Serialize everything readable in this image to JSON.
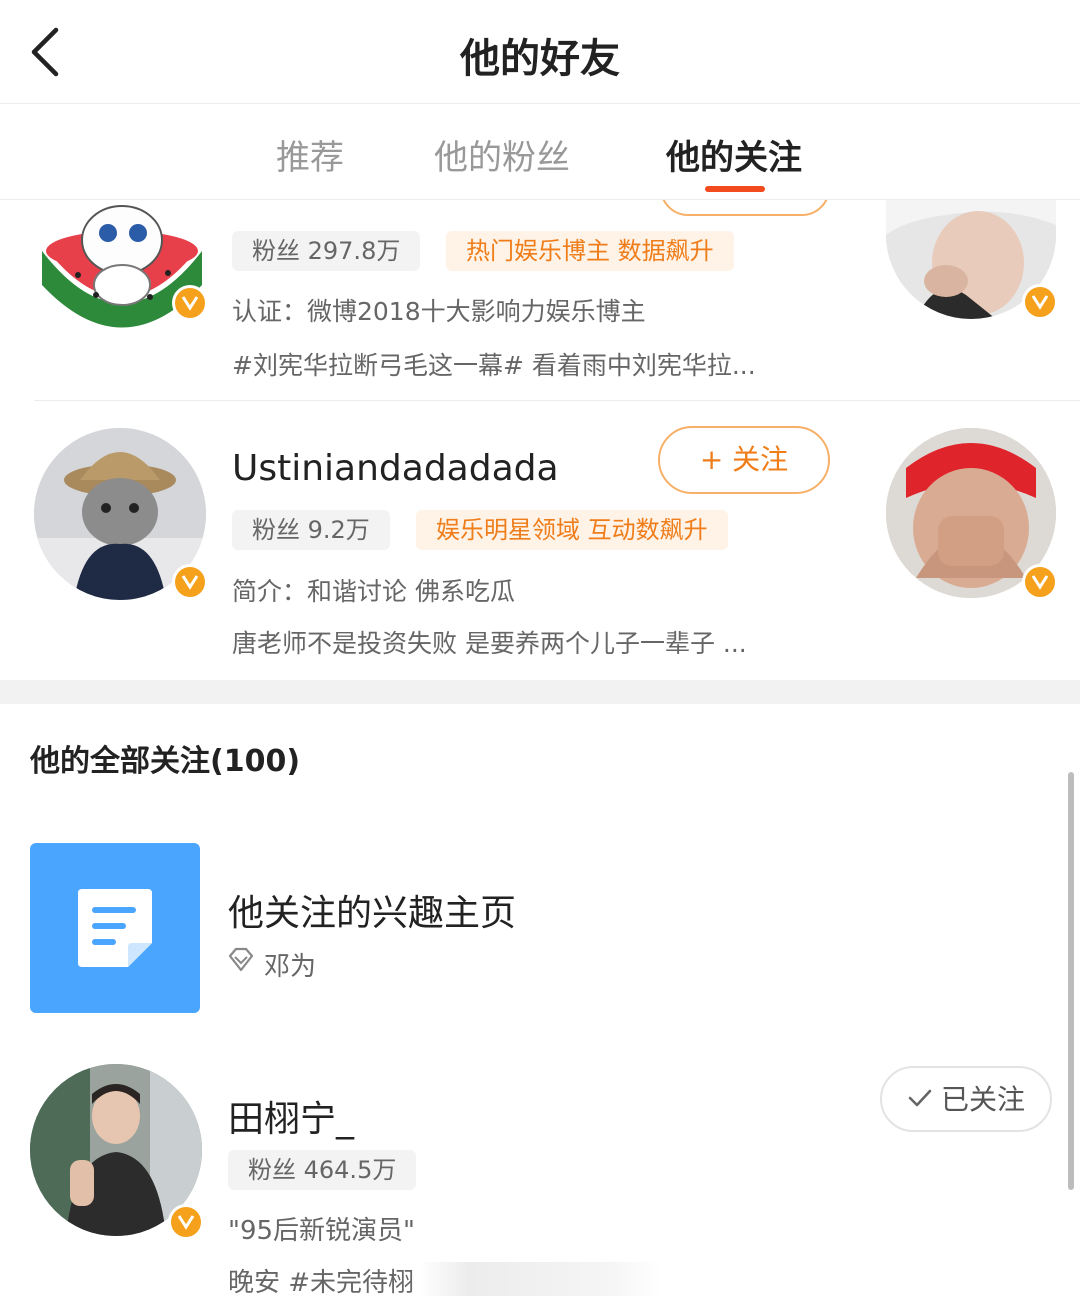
{
  "header": {
    "title": "他的好友",
    "back_icon": "chevron-left-icon"
  },
  "tabs": [
    {
      "label": "推荐",
      "active": false
    },
    {
      "label": "他的粉丝",
      "active": false
    },
    {
      "label": "他的关注",
      "active": true
    }
  ],
  "colors": {
    "accent": "#f24c1e",
    "orange_text": "#ef7d1a",
    "badge": "#f5a11c",
    "interest_blue": "#4aa5ff"
  },
  "recommend_cards": [
    {
      "name": "",
      "fans_chip": "粉丝 297.8万",
      "tag_chip": "热门娱乐博主 数据飙升",
      "line1": "认证：微博2018十大影响力娱乐博主",
      "line2": "#刘宪华拉断弓毛这一幕# 看着雨中刘宪华拉..."
    },
    {
      "name": "Ustiniandadadada",
      "follow_label": "+ 关注",
      "fans_chip": "粉丝 9.2万",
      "tag_chip": "娱乐明星领域 互动数飙升",
      "line1": "简介：和谐讨论 佛系吃瓜",
      "line2": "唐老师不是投资失败 是要养两个儿子一辈子 ..."
    }
  ],
  "all_follows": {
    "title": "他的全部关注(100)",
    "interest": {
      "name": "他关注的兴趣主页",
      "sub": "邓为",
      "icon": "document-icon"
    },
    "user": {
      "name": "田栩宁_",
      "followed_label": "已关注",
      "fans_chip": "粉丝 464.5万",
      "line1": "\"95后新锐演员\"",
      "line2": "晚安 #未完待栩"
    }
  }
}
